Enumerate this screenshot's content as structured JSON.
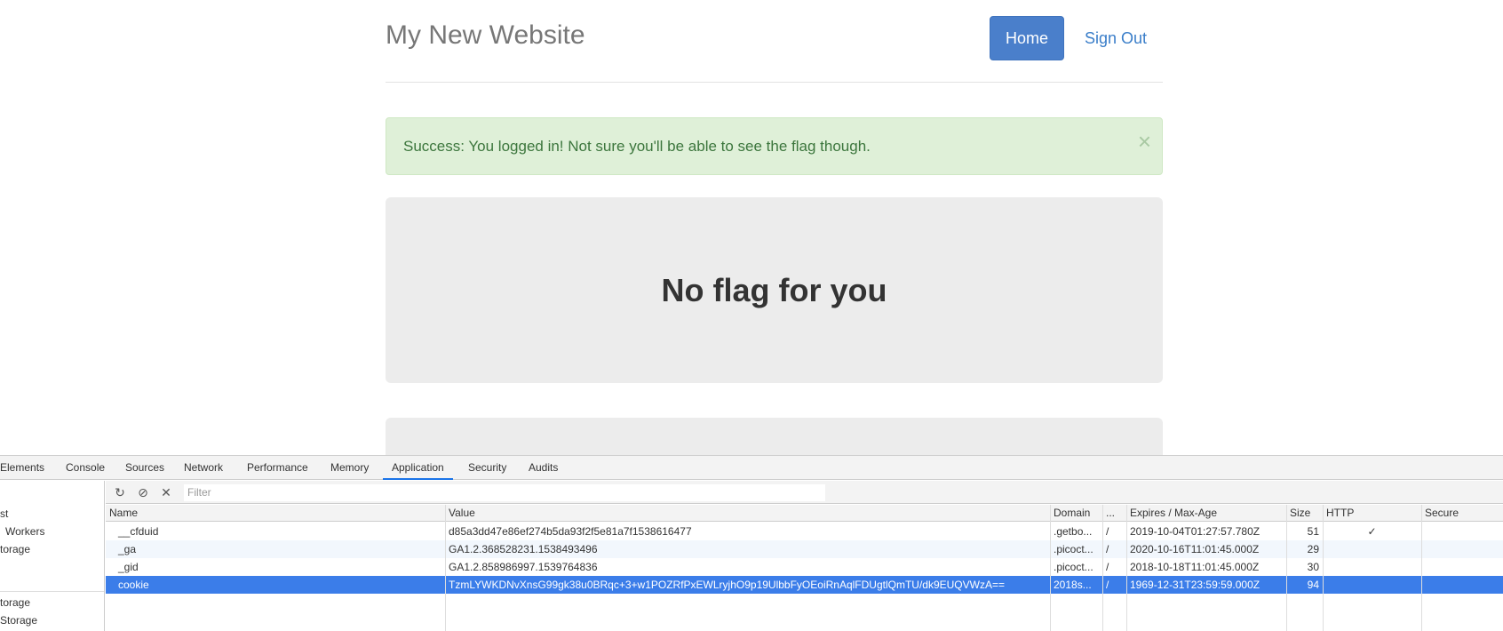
{
  "site": {
    "title": "My New Website",
    "nav": {
      "home": "Home",
      "sign_out": "Sign Out"
    },
    "alert": {
      "message": "Success: You logged in! Not sure you'll be able to see the flag though.",
      "close": "×"
    },
    "jumbotron": {
      "heading": "No flag for you"
    }
  },
  "devtools": {
    "tabs": [
      "Elements",
      "Console",
      "Sources",
      "Network",
      "Performance",
      "Memory",
      "Application",
      "Security",
      "Audits"
    ],
    "active_tab": "Application",
    "sidebar": [
      "st",
      "Workers",
      "torage",
      "torage",
      "Storage"
    ],
    "toolbar": {
      "refresh_icon": "↻",
      "clear_icon": "⊘",
      "delete_icon": "✕",
      "filter_placeholder": "Filter"
    },
    "columns": [
      "Name",
      "Value",
      "Domain",
      "...",
      "Expires / Max-Age",
      "Size",
      "HTTP",
      "Secure"
    ],
    "cookies": [
      {
        "name": "__cfduid",
        "value": "d85a3dd47e86ef274b5da93f2f5e81a7f1538616477",
        "domain": ".getbo...",
        "path": "/",
        "expires": "2019-10-04T01:27:57.780Z",
        "size": "51",
        "http": "✓",
        "secure": ""
      },
      {
        "name": "_ga",
        "value": "GA1.2.368528231.1538493496",
        "domain": ".picoct...",
        "path": "/",
        "expires": "2020-10-16T11:01:45.000Z",
        "size": "29",
        "http": "",
        "secure": ""
      },
      {
        "name": "_gid",
        "value": "GA1.2.858986997.1539764836",
        "domain": ".picoct...",
        "path": "/",
        "expires": "2018-10-18T11:01:45.000Z",
        "size": "30",
        "http": "",
        "secure": ""
      },
      {
        "name": "cookie",
        "value": "TzmLYWKDNvXnsG99gk38u0BRqc+3+w1POZRfPxEWLryjhO9p19UlbbFyOEoiRnAqlFDUgtlQmTU/dk9EUQVWzA==",
        "domain": "2018s...",
        "path": "/",
        "expires": "1969-12-31T23:59:59.000Z",
        "size": "94",
        "http": "",
        "secure": ""
      }
    ],
    "selected_row": 3,
    "colors": {
      "selection": "#3b7de9",
      "active_tab_underline": "#1a73e8"
    }
  }
}
